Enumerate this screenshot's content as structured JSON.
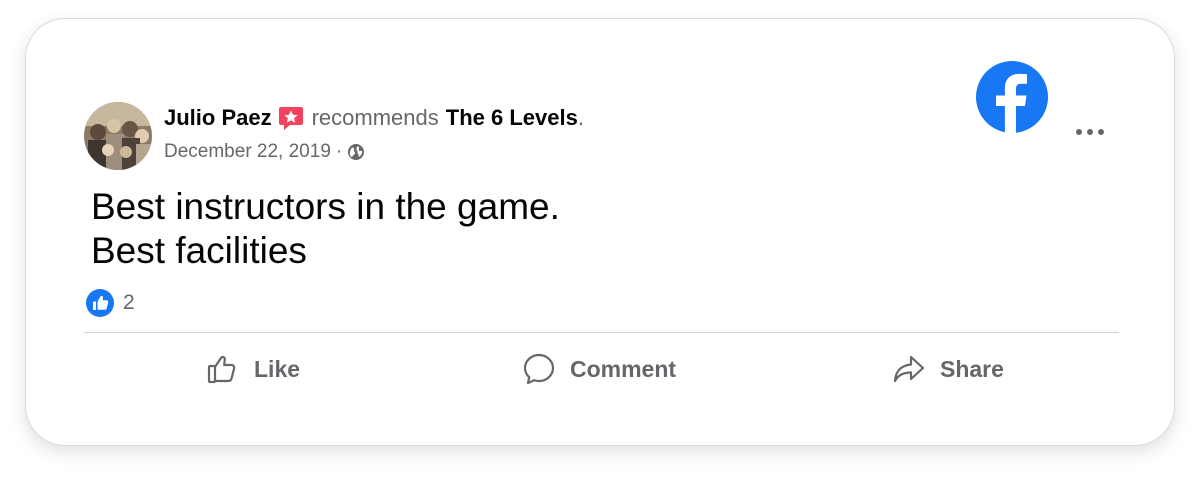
{
  "post": {
    "author": "Julio Paez",
    "verb": "recommends",
    "page_name": "The 6 Levels",
    "punct": ".",
    "date": "December 22, 2019",
    "separator": "·",
    "text_line1": "Best instructors in the game.",
    "text_line2": "Best facilities",
    "reaction_count": "2"
  },
  "actions": {
    "like": "Like",
    "comment": "Comment",
    "share": "Share"
  },
  "icons": {
    "brand": "facebook-logo-icon",
    "more": "more-options-icon",
    "recommend": "recommend-badge-icon",
    "privacy": "globe-icon",
    "reaction": "like-reaction-icon",
    "like": "thumbs-up-icon",
    "comment": "comment-bubble-icon",
    "share": "share-arrow-icon"
  },
  "colors": {
    "facebook_blue": "#1877f2",
    "recommend_badge": "#f3425f",
    "text_primary": "#050505",
    "text_secondary": "#65676b"
  }
}
